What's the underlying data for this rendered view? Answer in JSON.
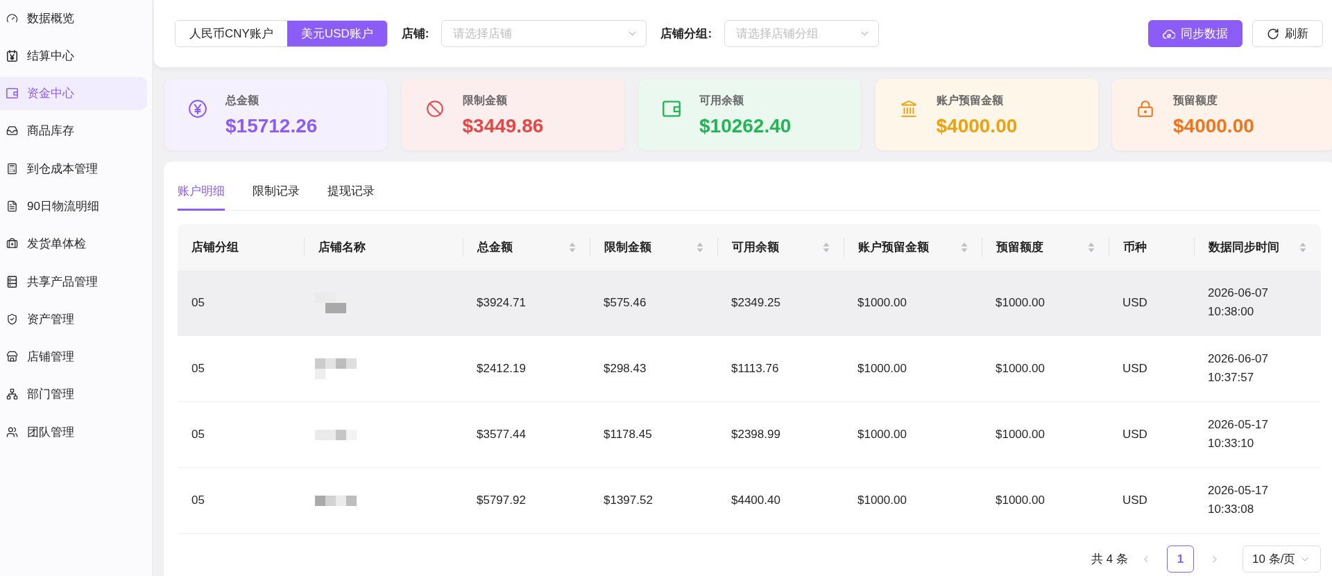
{
  "sidebar": {
    "items": [
      {
        "label": "数据概览",
        "selected": false
      },
      {
        "label": "结算中心",
        "selected": false
      },
      {
        "label": "资金中心",
        "selected": true
      },
      {
        "label": "商品库存",
        "selected": false
      },
      {
        "label": "到仓成本管理",
        "selected": false
      },
      {
        "label": "90日物流明细",
        "selected": false
      },
      {
        "label": "发货单体检",
        "selected": false
      },
      {
        "label": "共享产品管理",
        "selected": false
      },
      {
        "label": "资产管理",
        "selected": false
      },
      {
        "label": "店铺管理",
        "selected": false
      },
      {
        "label": "部门管理",
        "selected": false
      },
      {
        "label": "团队管理",
        "selected": false
      }
    ]
  },
  "toolbar": {
    "account_tabs": [
      {
        "label": "人民币CNY账户",
        "selected": false
      },
      {
        "label": "美元USD账户",
        "selected": true
      }
    ],
    "filters": [
      {
        "label": "店铺:",
        "placeholder": "请选择店铺"
      },
      {
        "label": "店铺分组:",
        "placeholder": "请选择店铺分组"
      }
    ],
    "buttons": [
      {
        "label": "同步数据",
        "kind": "primary"
      },
      {
        "label": "刷新",
        "kind": "default"
      }
    ]
  },
  "summary_cards": [
    {
      "label": "总金额",
      "value": "$15712.26",
      "color": "#8b5cf6"
    },
    {
      "label": "限制金额",
      "value": "$3449.86",
      "color": "#e84545"
    },
    {
      "label": "可用余额",
      "value": "$10262.40",
      "color": "#22b455"
    },
    {
      "label": "账户预留金额",
      "value": "$4000.00",
      "color": "#f0a00c"
    },
    {
      "label": "预留额度",
      "value": "$4000.00",
      "color": "#f37318"
    }
  ],
  "tabs": [
    {
      "label": "账户明细",
      "selected": true
    },
    {
      "label": "限制记录",
      "selected": false
    },
    {
      "label": "提现记录",
      "selected": false
    }
  ],
  "table": {
    "columns": [
      {
        "label": "店铺分组",
        "sortable": false
      },
      {
        "label": "店铺名称",
        "sortable": false
      },
      {
        "label": "总金额",
        "sortable": true
      },
      {
        "label": "限制金额",
        "sortable": true
      },
      {
        "label": "可用余额",
        "sortable": true
      },
      {
        "label": "账户预留金额",
        "sortable": true
      },
      {
        "label": "预留额度",
        "sortable": true
      },
      {
        "label": "币种",
        "sortable": false
      },
      {
        "label": "数据同步时间",
        "sortable": true
      }
    ],
    "rows": [
      {
        "highlighted": true,
        "shop_group": "05",
        "total": "$3924.71",
        "restricted": "$575.46",
        "available": "$2349.25",
        "account_reserved": "$1000.00",
        "reserved_limit": "$1000.00",
        "currency": "USD",
        "sync_time": "2026-06-07 10:38:00"
      },
      {
        "highlighted": false,
        "shop_group": "05",
        "total": "$2412.19",
        "restricted": "$298.43",
        "available": "$1113.76",
        "account_reserved": "$1000.00",
        "reserved_limit": "$1000.00",
        "currency": "USD",
        "sync_time": "2026-06-07 10:37:57"
      },
      {
        "highlighted": false,
        "shop_group": "05",
        "total": "$3577.44",
        "restricted": "$1178.45",
        "available": "$2398.99",
        "account_reserved": "$1000.00",
        "reserved_limit": "$1000.00",
        "currency": "USD",
        "sync_time": "2026-05-17 10:33:10"
      },
      {
        "highlighted": false,
        "shop_group": "05",
        "total": "$5797.92",
        "restricted": "$1397.52",
        "available": "$4400.40",
        "account_reserved": "$1000.00",
        "reserved_limit": "$1000.00",
        "currency": "USD",
        "sync_time": "2026-05-17 10:33:08"
      }
    ]
  },
  "pagination": {
    "total": "共 4 条",
    "previous": {
      "disabled": true
    },
    "pages": [
      {
        "label": "1",
        "selected": true
      }
    ],
    "next": {
      "disabled": true
    },
    "page_size": "10 条/页"
  }
}
